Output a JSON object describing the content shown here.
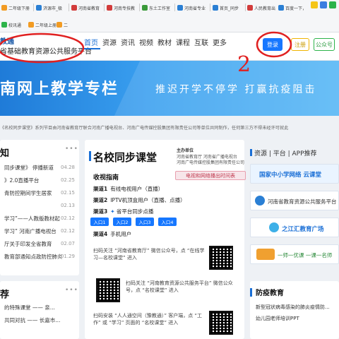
{
  "bookmarks": [
    "二年级下册",
    "济源市_极",
    "河南省教育",
    "河南专技教",
    "东土工作室",
    "河南省专业",
    "首页_同步",
    "人民教育出",
    "百度一下，",
    "校讯通",
    "二年级上册",
    "二"
  ],
  "header": {
    "logo_title": "教通",
    "logo_subtitle": "省基础教育资源公共服务平台",
    "nav": [
      "首页",
      "资源",
      "资讯",
      "视频",
      "教材",
      "课程",
      "互联",
      "更多"
    ],
    "login_label": "登录",
    "register_label": "注册",
    "wechat_label": "公众号"
  },
  "banner": {
    "title": "南网上教学专栏",
    "slogan": "推迟开学不停学  打赢抗疫阻击"
  },
  "notice": "《名校同步课堂》系列节目由河南省教育厅联合河南广播电视台、河南广电传媒控股集团有限责任公司等单位共同制作，任何第三方不得未经许可就此",
  "news": {
    "title": "知",
    "items": [
      {
        "text": "同步课堂》  停播新道",
        "date": "04.28"
      },
      {
        "text": "》2.0直播平台",
        "date": "02.25"
      },
      {
        "text": "青防控期间学生居家",
        "date": "02.15"
      },
      {
        "text": "",
        "date": "02.13"
      },
      {
        "text": "学习”——人教版教材起",
        "date": "02.12"
      },
      {
        "text": "学习”  河南广播电视台",
        "date": "02.12"
      },
      {
        "text": "厅关于印发全省教育",
        "date": "02.07"
      },
      {
        "text": "教育部通知点政防控肺炎",
        "date": "01.29"
      }
    ]
  },
  "sync": {
    "title": "名校同步课堂",
    "host_label": "主办单位",
    "hosts": [
      "河南省教育厅  河南省广播电视台",
      "河南广电传媒控股集团有限责任公司"
    ],
    "guide_title": "收视指南",
    "guide_button": "电视和网络播出时间表",
    "channels": [
      {
        "name": "渠道1",
        "desc": "有线电视用户（直播）"
      },
      {
        "name": "渠道2",
        "desc": "IPTV机顶盒用户（直播、点播）"
      },
      {
        "name": "渠道3",
        "desc": "省平台同步点播"
      },
      {
        "name": "渠道4",
        "desc": "手机用户"
      }
    ],
    "entries": [
      "入口1",
      "入口2",
      "入口3",
      "入口4"
    ],
    "qr1_text": "扫码关注 “河南省教育厅” 微信公众号，点 “在线学习—名校课堂” 进入",
    "qr2_text": "扫码关注 “河南教育资源公共服务平台” 微信公众号，点 “名校课堂” 进入",
    "qr3_text": "扫码安装 “人人通空间（豫教通）” 客户端，点 “工作” 或 “学习” 页面的 “名校课堂” 进入"
  },
  "resources": {
    "heading": "资源 | 平台 | APP推荐",
    "items": [
      "国家中小学网络 云课堂",
      "河南省教育资源公共服务平台",
      "之江汇教育广场",
      "一师一优课 一课一名师"
    ]
  },
  "recommend": {
    "title": "荐",
    "items": [
      "的特殊课堂 —— 亲...",
      "共同对抗 —— 长嘉市..."
    ]
  },
  "epidemic": {
    "title": "防疫教育",
    "items": [
      "新型冠状病毒感染的肺炎疫情防...",
      "幼儿园老师培训PPT"
    ]
  },
  "annotations": {
    "number": "2"
  },
  "colors": {
    "accent": "#1a6fd6",
    "login": "#1677ff",
    "annotation": "#e02020"
  }
}
